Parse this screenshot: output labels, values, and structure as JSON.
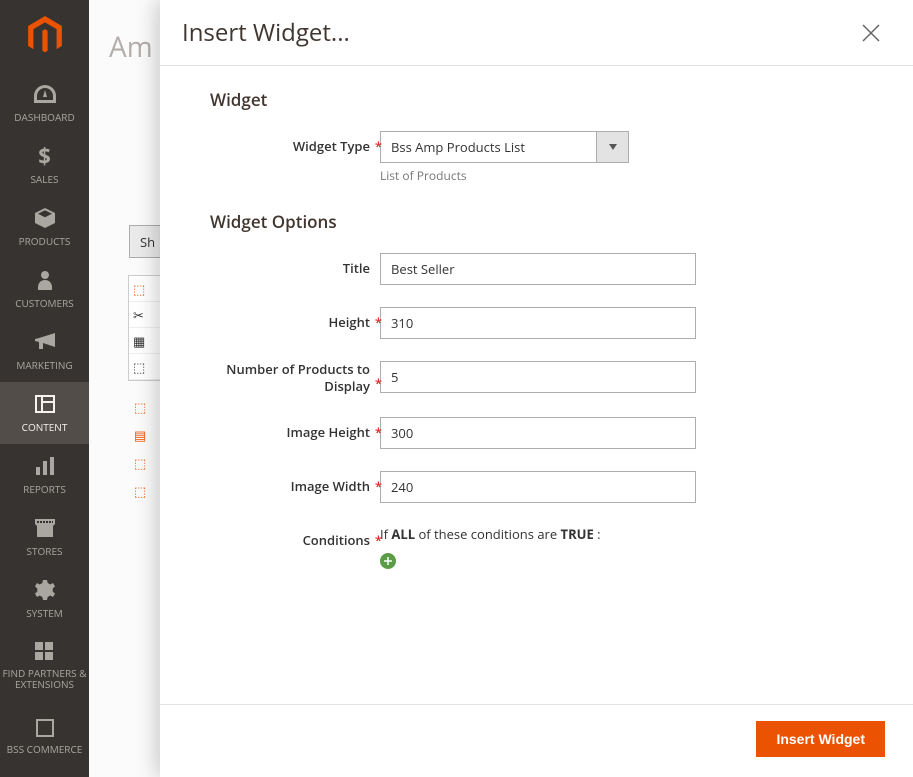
{
  "sidebar": {
    "items": [
      {
        "label": "Dashboard"
      },
      {
        "label": "Sales"
      },
      {
        "label": "Products"
      },
      {
        "label": "Customers"
      },
      {
        "label": "Marketing"
      },
      {
        "label": "Content"
      },
      {
        "label": "Reports"
      },
      {
        "label": "Stores"
      },
      {
        "label": "System"
      },
      {
        "label": "Find Partners & Extensions"
      },
      {
        "label": "BSS Commerce"
      }
    ]
  },
  "page": {
    "title_fragment": "Am",
    "sh_fragment": "Sh"
  },
  "modal": {
    "title": "Insert Widget...",
    "section_widget": "Widget",
    "section_options": "Widget Options",
    "fields": {
      "widget_type": {
        "label": "Widget Type",
        "value": "Bss Amp Products List",
        "note": "List of Products"
      },
      "title": {
        "label": "Title",
        "value": "Best Seller"
      },
      "height": {
        "label": "Height",
        "value": "310"
      },
      "num_products": {
        "label": "Number of Products to Display",
        "value": "5"
      },
      "image_height": {
        "label": "Image Height",
        "value": "300"
      },
      "image_width": {
        "label": "Image Width",
        "value": "240"
      },
      "conditions": {
        "label": "Conditions",
        "prefix": "If ",
        "agg": "ALL",
        "mid": " of these conditions are ",
        "val": "TRUE",
        "suffix": " :"
      }
    },
    "submit": "Insert Widget"
  }
}
